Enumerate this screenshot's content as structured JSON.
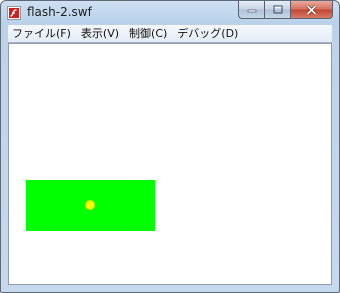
{
  "window": {
    "title": "flash-2.swf",
    "icon": "flash-player-icon"
  },
  "caption_buttons": {
    "minimize": "minimize-icon",
    "maximize": "maximize-icon",
    "close": "close-icon"
  },
  "menubar": {
    "items": [
      {
        "label": "ファイル(F)"
      },
      {
        "label": "表示(V)"
      },
      {
        "label": "制御(C)"
      },
      {
        "label": "デバッグ(D)"
      }
    ]
  },
  "stage": {
    "background": "#ffffff",
    "rect_color": "#00ff00",
    "dot_color": "#ffff00"
  }
}
